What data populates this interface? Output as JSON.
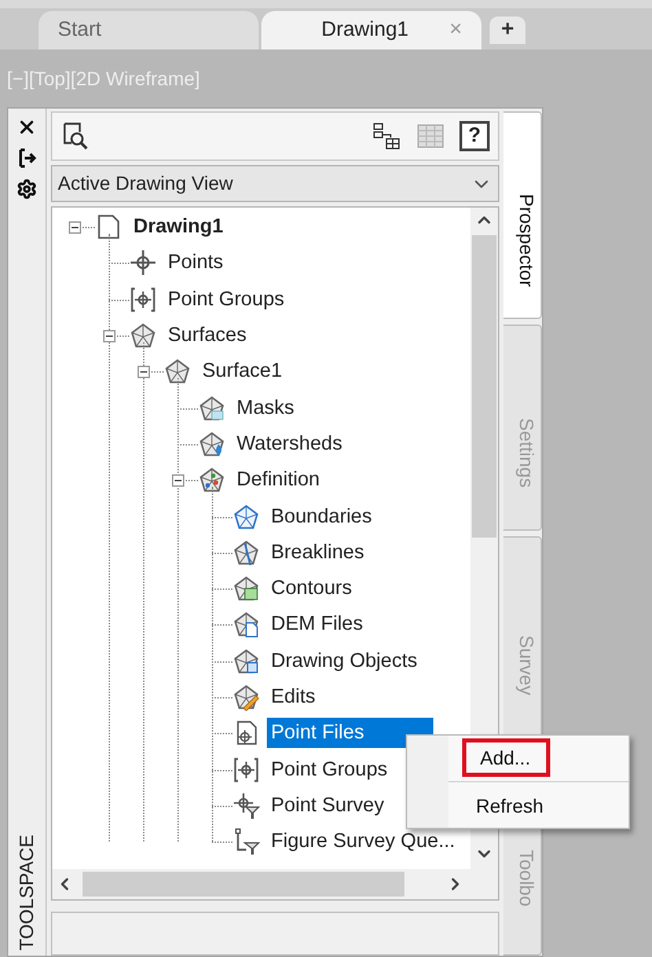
{
  "tabs": [
    {
      "label": "Start",
      "selected": false
    },
    {
      "label": "Drawing1",
      "selected": true,
      "close": "×"
    }
  ],
  "new_tab": "+",
  "viewport_label": "[−][Top][2D Wireframe]",
  "toolspace": {
    "title": "TOOLSPACE",
    "help": "?",
    "view_select": {
      "value": "Active Drawing View"
    },
    "tree": [
      {
        "label": "Drawing1",
        "kind": "document",
        "expanded": true,
        "selected": false,
        "children": [
          {
            "label": "Points",
            "kind": "points",
            "selected": false
          },
          {
            "label": "Point Groups",
            "kind": "group",
            "selected": false
          },
          {
            "label": "Surfaces",
            "kind": "surface",
            "expanded": true,
            "selected": false,
            "children": [
              {
                "label": "Surface1",
                "kind": "surface",
                "expanded": true,
                "selected": false,
                "children": [
                  {
                    "label": "Masks",
                    "kind": "mask",
                    "selected": false
                  },
                  {
                    "label": "Watersheds",
                    "kind": "watershed",
                    "selected": false
                  },
                  {
                    "label": "Definition",
                    "kind": "definition",
                    "expanded": true,
                    "selected": false,
                    "children": [
                      {
                        "label": "Boundaries",
                        "kind": "boundary",
                        "selected": false
                      },
                      {
                        "label": "Breaklines",
                        "kind": "breakline",
                        "selected": false
                      },
                      {
                        "label": "Contours",
                        "kind": "contour",
                        "selected": false
                      },
                      {
                        "label": "DEM Files",
                        "kind": "dem",
                        "selected": false
                      },
                      {
                        "label": "Drawing Objects",
                        "kind": "objects",
                        "selected": false
                      },
                      {
                        "label": "Edits",
                        "kind": "edits",
                        "selected": false
                      },
                      {
                        "label": "Point Files",
                        "kind": "pointfile",
                        "selected": true
                      },
                      {
                        "label": "Point Groups",
                        "kind": "group",
                        "selected": false
                      },
                      {
                        "label": "Point Survey",
                        "kind": "query",
                        "selected": false
                      },
                      {
                        "label": "Figure Survey Que...",
                        "kind": "figquery",
                        "selected": false
                      }
                    ]
                  }
                ]
              }
            ]
          }
        ]
      }
    ],
    "side_tabs": [
      {
        "label": "Prospector",
        "selected": true
      },
      {
        "label": "Settings",
        "selected": false
      },
      {
        "label": "Survey",
        "selected": false
      },
      {
        "label": "Toolbo",
        "selected": false
      }
    ]
  },
  "context_menu": {
    "items": [
      {
        "label": "Add...",
        "outlined": true
      },
      {
        "label": "Refresh",
        "outlined": false
      }
    ]
  }
}
